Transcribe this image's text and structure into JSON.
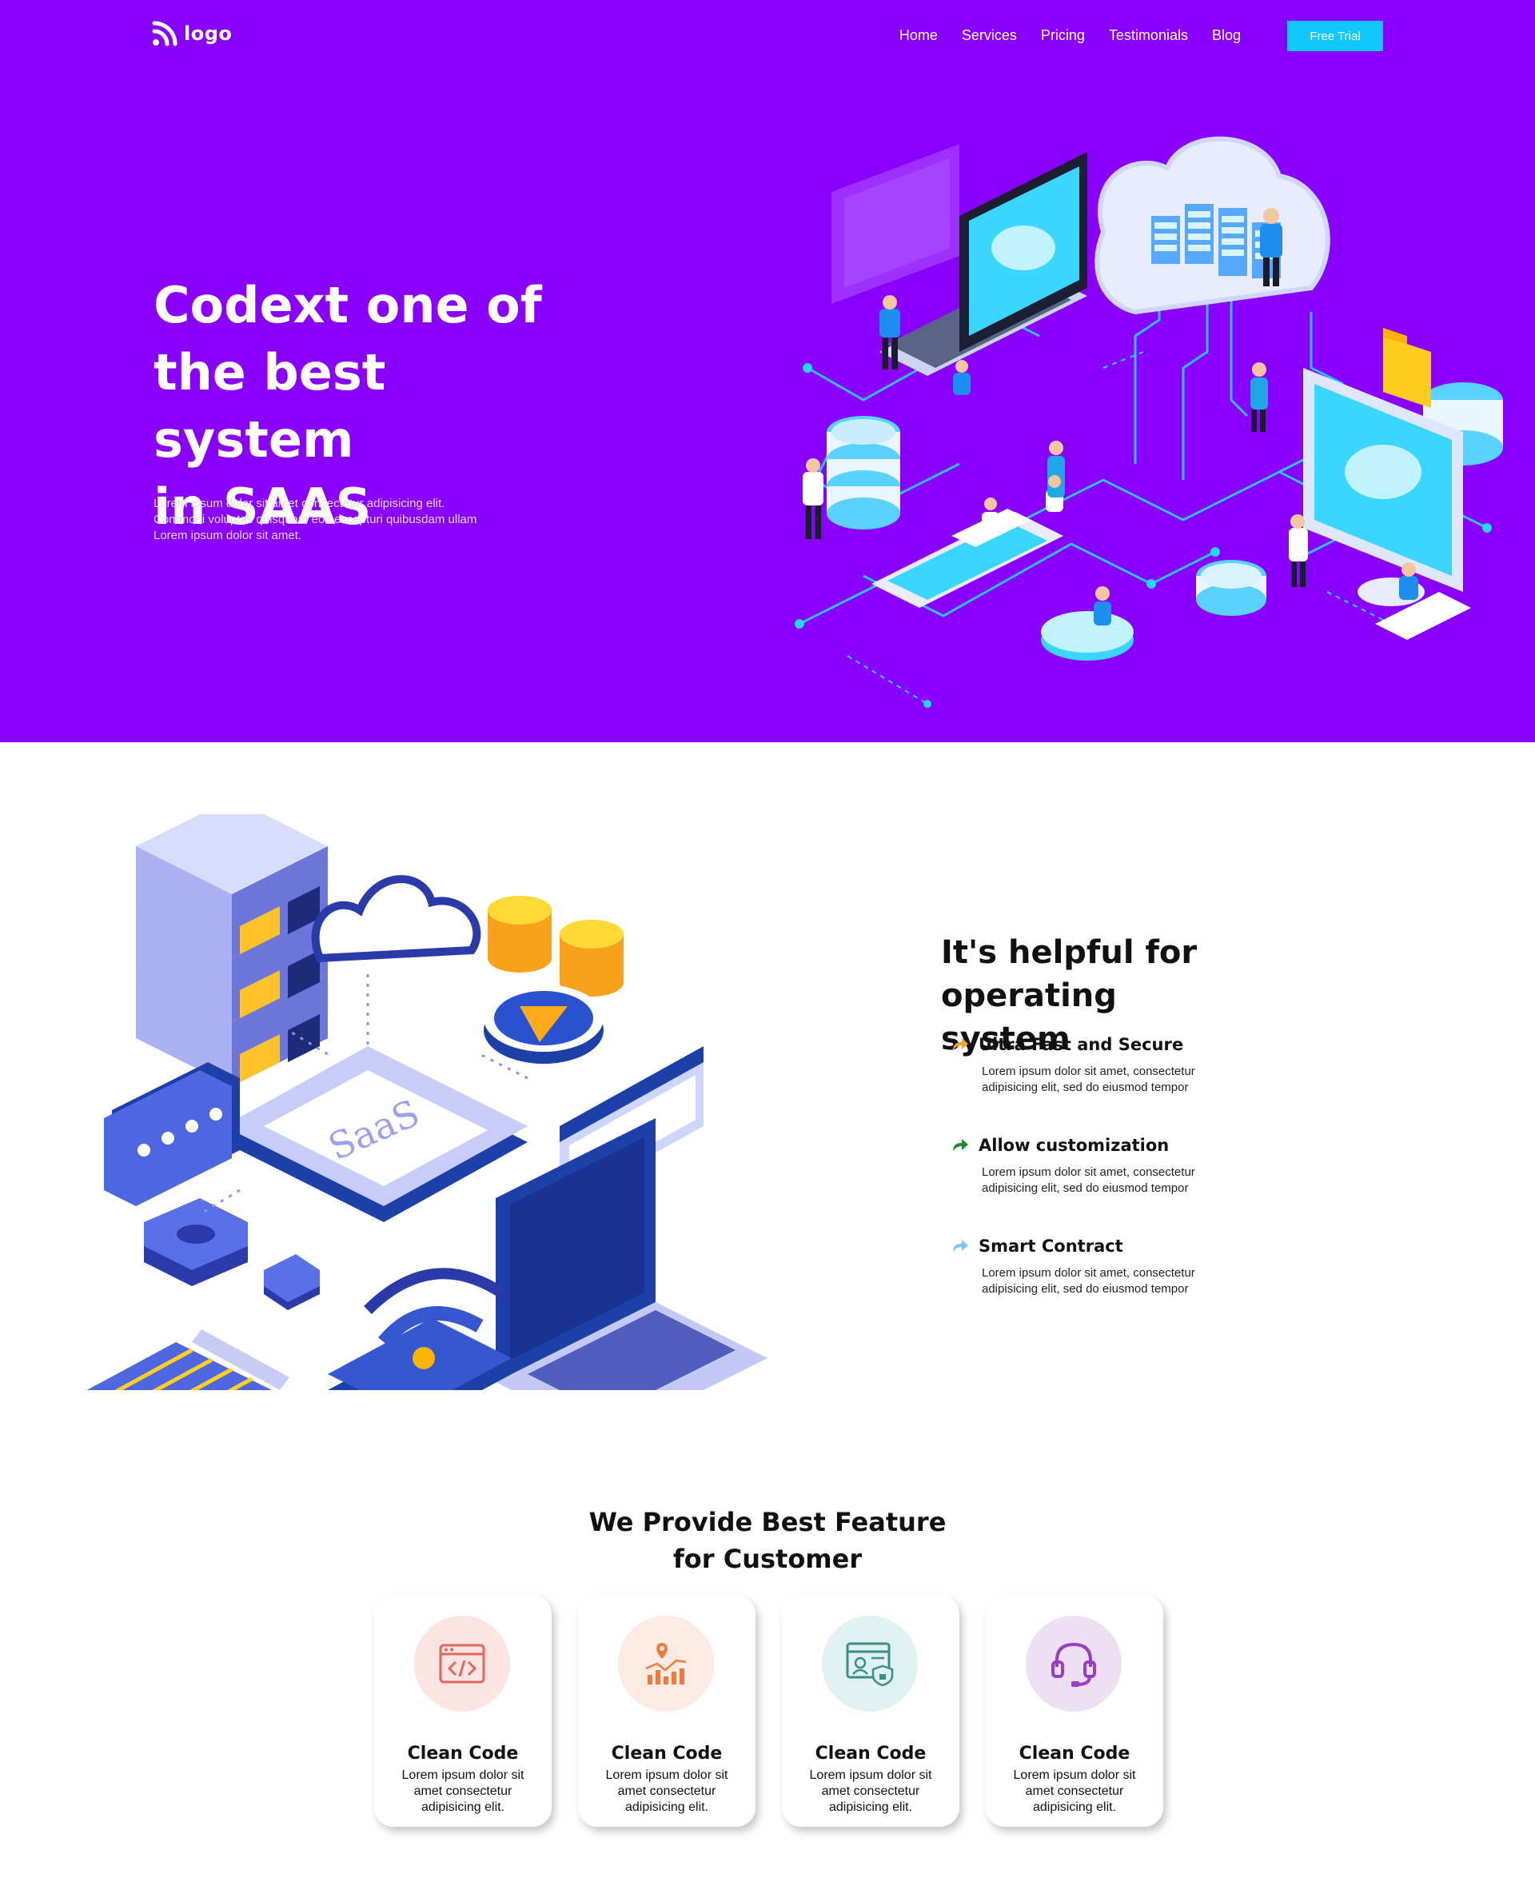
{
  "nav": {
    "logo_text": "logo",
    "links": [
      "Home",
      "Services",
      "Pricing",
      "Testimonials",
      "Blog"
    ],
    "cta_label": "Free Trial"
  },
  "hero": {
    "title_lines": [
      "Codext one of",
      "the best system",
      "in SAAS"
    ],
    "subtitle_lines": [
      "Lorem ipsum dolor sit amet consectetur adipisicing elit.",
      "Commodi voluptas quisquam eos excepturi quibusdam ullam",
      "Lorem ipsum dolor sit amet."
    ],
    "bg_color": "#8a00ff"
  },
  "section2": {
    "title_lines": [
      "It's helpful for operating",
      "system"
    ],
    "illustration_label": "SaaS",
    "features": [
      {
        "title": "Ultra Fast and Secure",
        "desc_lines": [
          "Lorem ipsum dolor sit amet, consectetur",
          "adipisicing elit, sed do eiusmod tempor"
        ],
        "icon": "arrow-share-icon",
        "icon_color": "#f5a623"
      },
      {
        "title": "Allow customization",
        "desc_lines": [
          "Lorem ipsum dolor sit amet, consectetur",
          "adipisicing elit, sed do eiusmod tempor"
        ],
        "icon": "arrow-share-icon",
        "icon_color": "#1f8a2e"
      },
      {
        "title": "Smart Contract",
        "desc_lines": [
          "Lorem ipsum dolor sit amet, consectetur",
          "adipisicing elit, sed do eiusmod tempor"
        ],
        "icon": "arrow-share-icon",
        "icon_color": "#7cc6ee"
      }
    ]
  },
  "section3": {
    "title_lines": [
      "We Provide Best Feature",
      "for Customer"
    ],
    "cards": [
      {
        "title": "Clean Code",
        "desc_lines": [
          "Lorem ipsum dolor sit",
          "amet consectetur",
          "adipisicing elit."
        ],
        "icon": "code-window-icon",
        "circle_color": "#fbe4e1",
        "icon_color": "#e0685a"
      },
      {
        "title": "Clean Code",
        "desc_lines": [
          "Lorem ipsum dolor sit",
          "amet consectetur",
          "adipisicing elit."
        ],
        "icon": "bar-chart-pin-icon",
        "circle_color": "#fdeae2",
        "icon_color": "#f07a3a"
      },
      {
        "title": "Clean Code",
        "desc_lines": [
          "Lorem ipsum dolor sit",
          "amet consectetur",
          "adipisicing elit."
        ],
        "icon": "security-profile-icon",
        "circle_color": "#dff1f0",
        "icon_color": "#3b8f8a"
      },
      {
        "title": "Clean Code",
        "desc_lines": [
          "Lorem ipsum dolor sit",
          "amet consectetur",
          "adipisicing elit."
        ],
        "icon": "headset-icon",
        "circle_color": "#ede0f3",
        "icon_color": "#9b3cc4"
      }
    ]
  }
}
